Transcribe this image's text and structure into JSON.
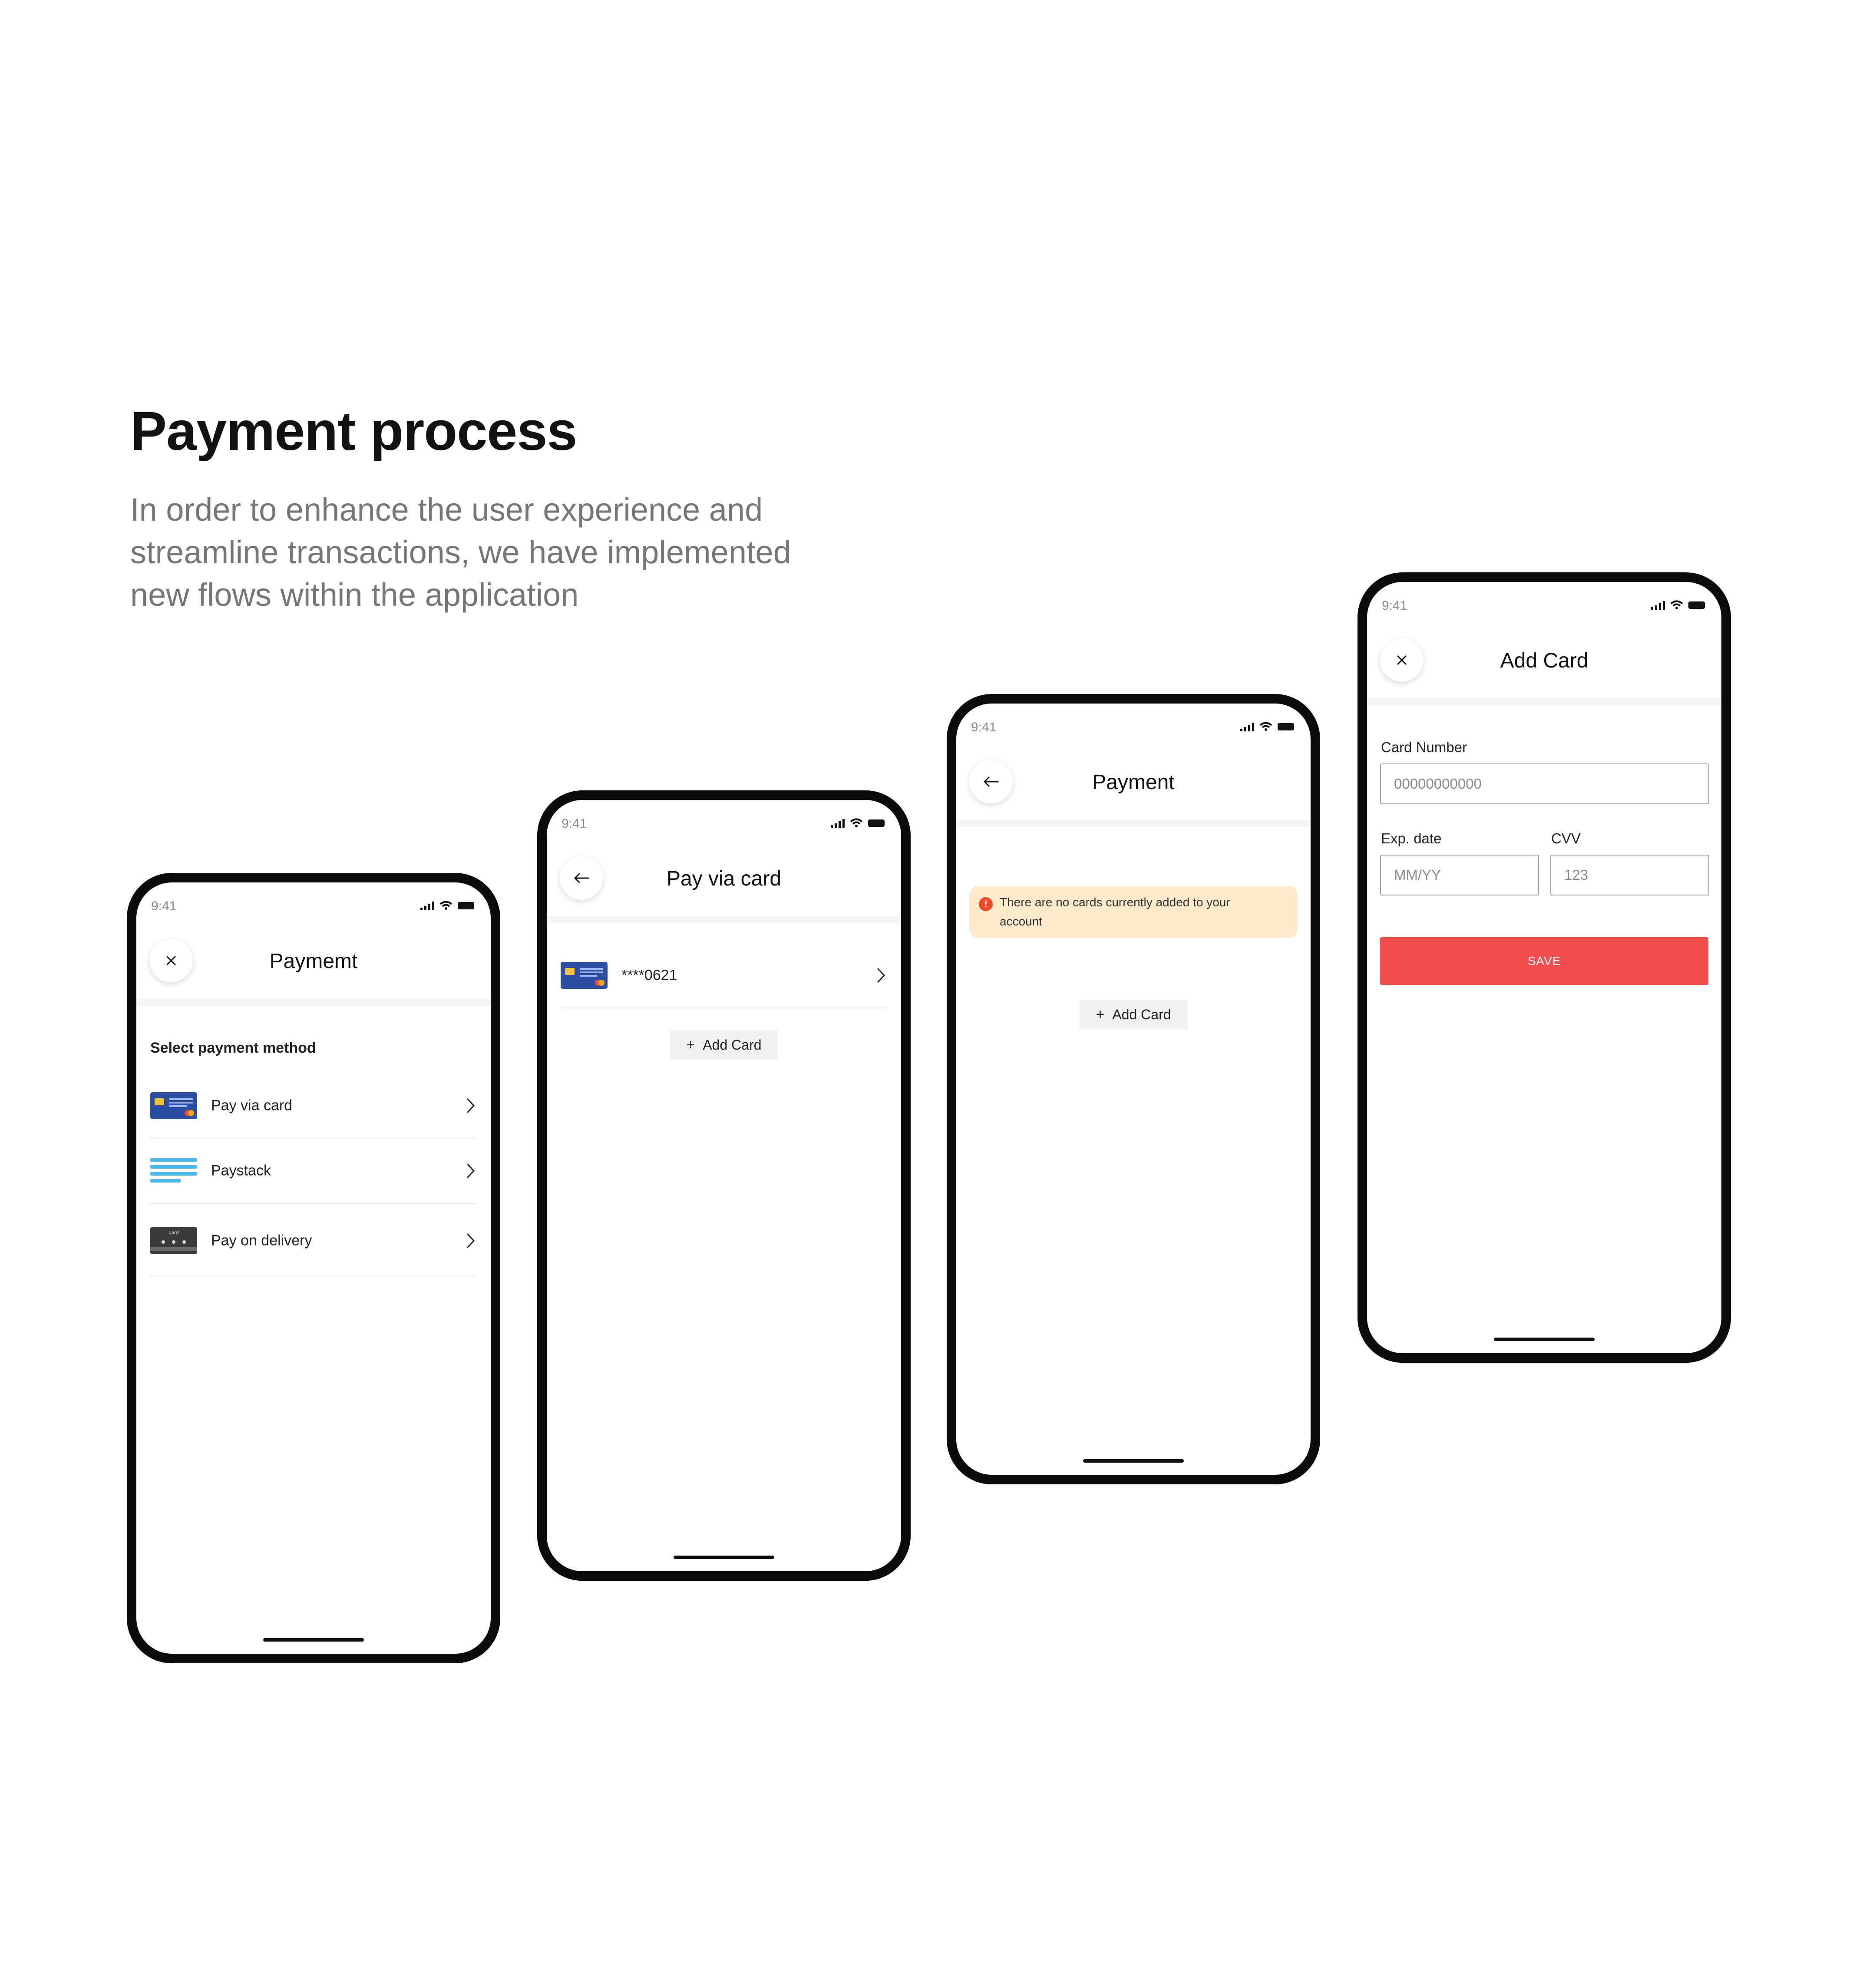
{
  "title": "Payment process",
  "description": "In order to enhance the user experience and streamline transactions, we have implemented new flows within the application",
  "colors": {
    "accent_red": "#f24b4b",
    "alert_bg": "#fde9cc",
    "alert_icon": "#f14a2a",
    "card_blue": "#2d4ea0",
    "paystack_blue": "#4cb8ea",
    "delivery_dark": "#3a3a3a"
  },
  "screens": {
    "select_method": {
      "time": "9:41",
      "title": "Paymemt",
      "close_icon": "close-icon",
      "section_label": "Select payment method",
      "methods": [
        {
          "label": "Pay via card",
          "icon": "credit-card-icon"
        },
        {
          "label": "Paystack",
          "icon": "paystack-icon"
        },
        {
          "label": "Pay on delivery",
          "icon": "cash-card-icon",
          "icon_text": "card"
        }
      ]
    },
    "pay_via_card": {
      "time": "9:41",
      "title": "Pay via card",
      "back_icon": "back-arrow-icon",
      "saved_card": "****0621",
      "add_card_label": "Add Card"
    },
    "payment_empty": {
      "time": "9:41",
      "title": "Payment",
      "back_icon": "back-arrow-icon",
      "alert_icon_text": "!",
      "alert_text": "There are no cards currently added to your account",
      "add_card_label": "Add Card"
    },
    "add_card": {
      "time": "9:41",
      "title": "Add Card",
      "close_icon": "close-icon",
      "card_number_label": "Card Number",
      "card_number_placeholder": "00000000000",
      "exp_label": "Exp. date",
      "exp_placeholder": "MM/YY",
      "cvv_label": "CVV",
      "cvv_placeholder": "123",
      "save_label": "SAVE"
    }
  }
}
